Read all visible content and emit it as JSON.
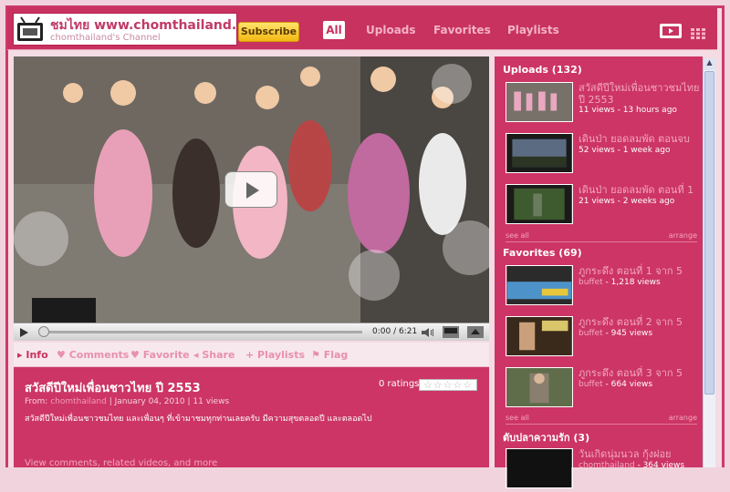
{
  "header": {
    "channel_title": "ชมไทย www.chomthailand.com",
    "channel_subtitle": "chomthailand's Channel",
    "subscribe_label": "Subscribe",
    "tabs": [
      "All",
      "Uploads",
      "Favorites",
      "Playlists"
    ]
  },
  "player": {
    "time": "0:00 / 6:21"
  },
  "actions": [
    "Info",
    "Comments",
    "Favorite",
    "Share",
    "Playlists",
    "Flag"
  ],
  "video": {
    "title": "สวัสดีปีใหม่เพื่อนชาวไทย ปี 2553",
    "ratings": "0 ratings",
    "from_label": "From:",
    "author": "chomthailand",
    "meta": "| January 04, 2010 | 11 views",
    "description": "สวัสดีปีใหม่เพื่อนชาวชมไทย และเพื่อนๆ ที่เข้ามาชมทุกท่านเลยครับ มีความสุขตลอดปี และตลอดไป",
    "more_link": "View comments, related videos, and more"
  },
  "sidebar": {
    "uploads_title": "Uploads (132)",
    "uploads": [
      {
        "title": "สวัสดีปีใหม่เพื่อนชาวชมไทย ปี 2553",
        "meta": "11 views - 13 hours ago"
      },
      {
        "title": "เดินป่า ยอดลมพัด ตอนจบ",
        "meta": "52 views - 1 week ago"
      },
      {
        "title": "เดินป่า ยอดลมพัด ตอนที่ 1",
        "meta": "21 views - 2 weeks ago"
      }
    ],
    "see_all": "see all",
    "arrange": "arrange",
    "favorites_title": "Favorites (69)",
    "favorites": [
      {
        "title": "ภูกระดึง ตอนที่ 1 จาก 5",
        "author": "buffet",
        "views": " - 1,218 views"
      },
      {
        "title": "ภูกระดึง ตอนที่ 2 จาก 5",
        "author": "buffet",
        "views": " - 945 views"
      },
      {
        "title": "ภูกระดึง ตอนที่ 3 จาก 5",
        "author": "buffet",
        "views": " - 664 views"
      }
    ],
    "playlist_title": "ตับปลาความรัก (3)",
    "playlist": [
      {
        "title": "วันเกิดนุ่มนวล กุ้งฝอย",
        "author": "chomthailand",
        "views": " - 364 views"
      }
    ]
  }
}
